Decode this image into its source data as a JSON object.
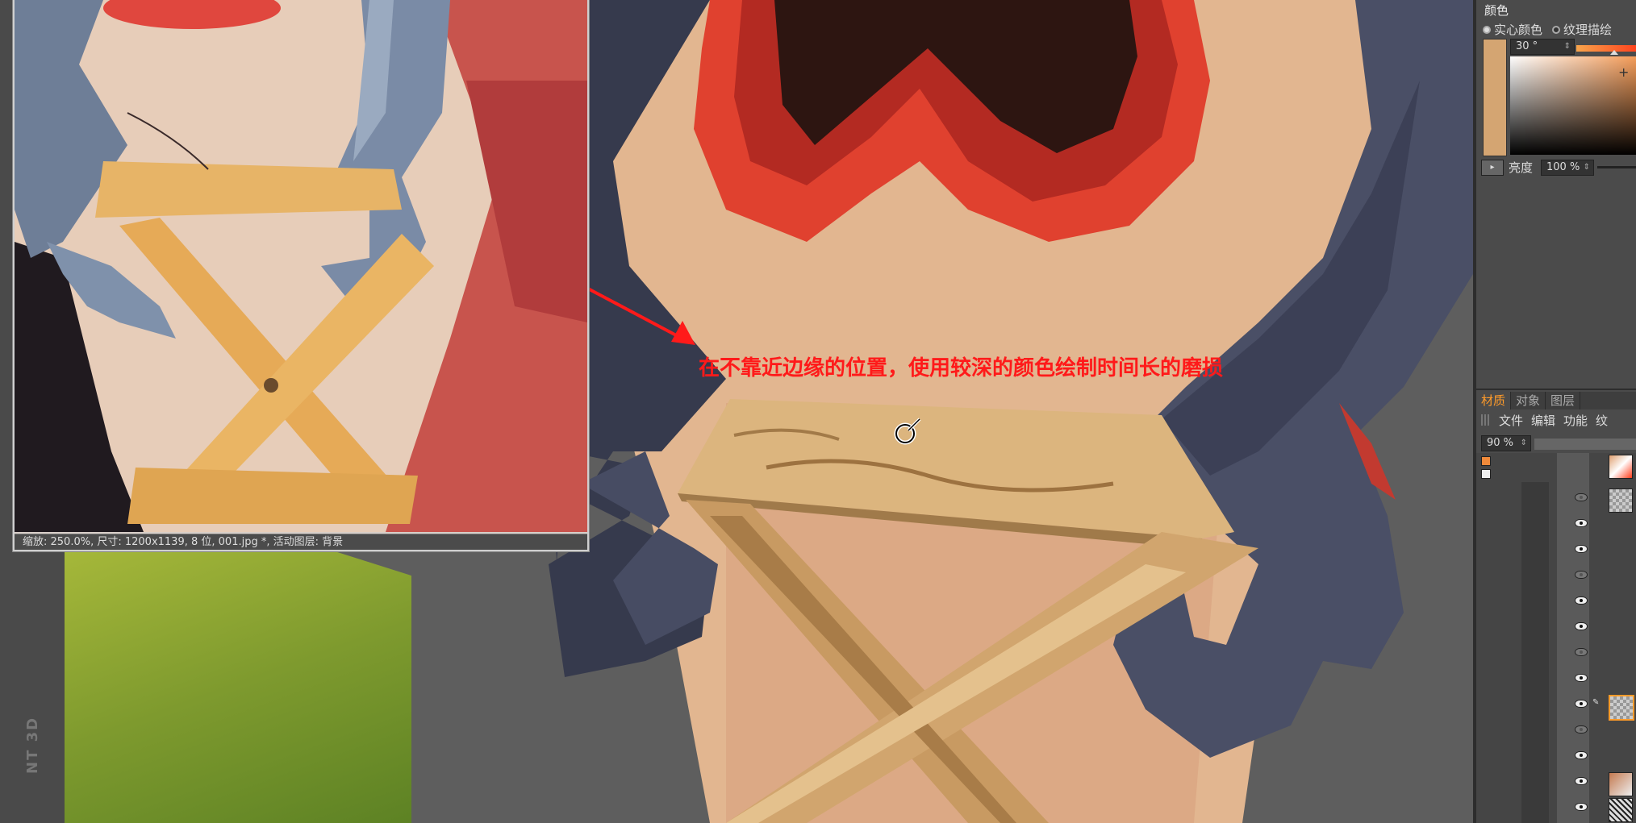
{
  "reference_window": {
    "status": "缩放: 250.0%, 尺寸: 1200x1139, 8 位, 001.jpg *, 活动图层: 背景"
  },
  "viewport": {
    "annotation": "在不靠近边缘的位置，使用较深的颜色绘制时间长的磨损",
    "watermark": "NT 3D",
    "accent_color": "#ff1a1a"
  },
  "color_panel": {
    "title": "颜色",
    "mode_solid": "实心颜色",
    "mode_texture": "纹理描绘",
    "selected_mode": "实心颜色",
    "current_color": "#d4a572",
    "hue_value": "30 °",
    "brightness_label": "亮度",
    "brightness_value": "100 %"
  },
  "material_panel": {
    "tabs": [
      "材质",
      "对象",
      "图层"
    ],
    "active_tab": "材质",
    "menu": [
      "文件",
      "编辑",
      "功能",
      "纹"
    ],
    "zoom_value": "90 %",
    "eye_icons": [
      "visible-eye-icon",
      "visible-eye-icon",
      "hidden-eye-icon",
      "visible-eye-icon",
      "visible-eye-icon",
      "hidden-eye-icon",
      "visible-eye-icon",
      "visible-eye-icon",
      "hidden-eye-icon",
      "visible-eye-icon",
      "visible-eye-icon",
      "visible-eye-icon",
      "visible-eye-icon"
    ]
  }
}
